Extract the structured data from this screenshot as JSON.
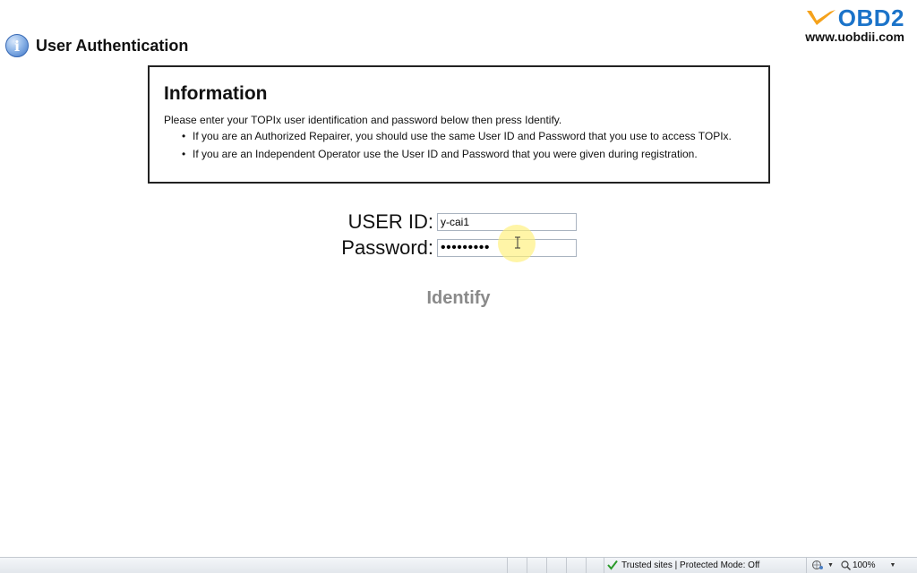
{
  "header": {
    "title": "User Authentication"
  },
  "brand": {
    "name": "OBD2",
    "url": "www.uobdii.com",
    "accent_color": "#f5a21b",
    "text_color": "#1b73c9"
  },
  "info_box": {
    "heading": "Information",
    "intro": "Please enter your TOPIx user identification and password below then press Identify.",
    "bullets": [
      "If you are an Authorized Repairer, you should use the same User ID and Password that you use to access TOPIx.",
      "If you are an Independent Operator use the User ID and Password that you were given during registration."
    ]
  },
  "form": {
    "user_id_label": "USER ID:",
    "user_id_value": "y-cai1",
    "password_label": "Password:",
    "password_value": "•••••••••",
    "identify_label": "Identify"
  },
  "status_bar": {
    "zone_text": "Trusted sites | Protected Mode: Off",
    "zoom": "100%"
  }
}
